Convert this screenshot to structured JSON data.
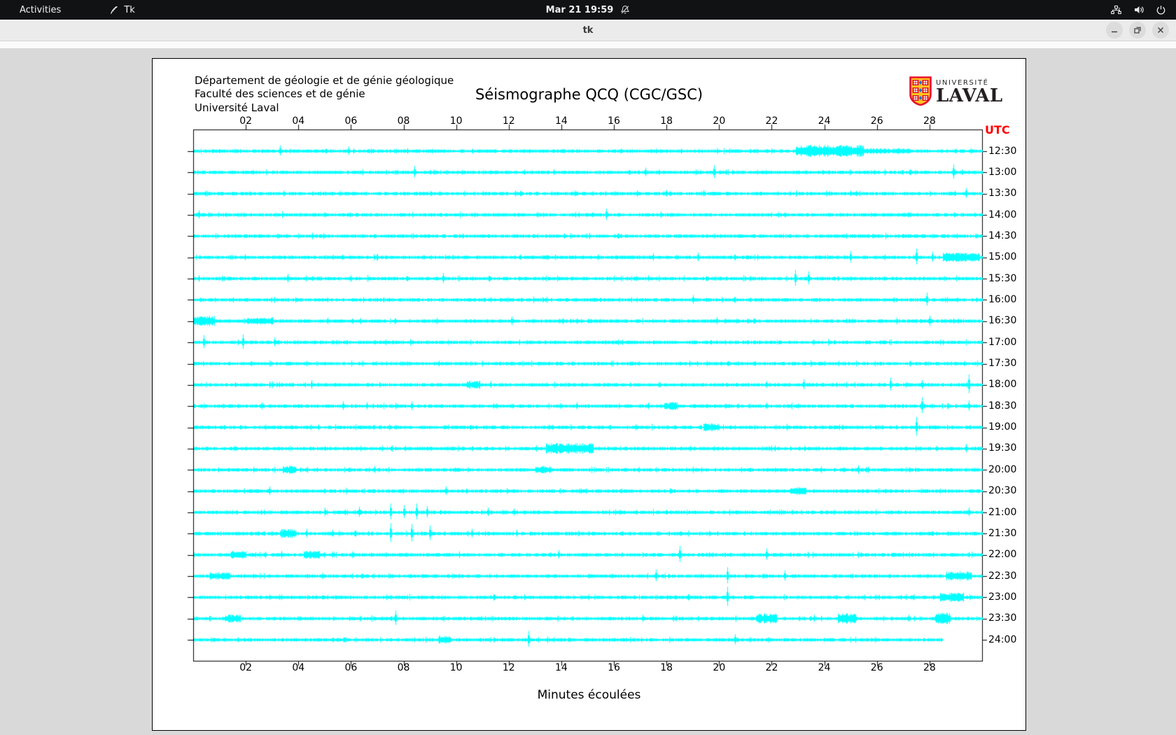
{
  "topbar": {
    "activities_label": "Activities",
    "app_name": "Tk",
    "clock": "Mar 21 19:59",
    "icons": [
      "feather-icon",
      "notifications-muted-icon",
      "network-icon",
      "volume-icon",
      "power-icon"
    ]
  },
  "titlebar": {
    "title": "tk",
    "buttons": [
      "minimize",
      "restore",
      "close"
    ]
  },
  "header": {
    "institution_lines": [
      "Département de géologie et de génie géologique",
      "Faculté des sciences et de génie",
      "Université Laval"
    ],
    "logo": {
      "line1": "UNIVERSITÉ",
      "line2": "LAVAL",
      "shield_colors": {
        "red": "#e8112d",
        "gold": "#ffc61e",
        "blue": "#1b7ac4",
        "white": "#ffffff"
      }
    }
  },
  "chart_data": {
    "type": "line",
    "subtype": "seismogram-helicorder",
    "title": "Séismographe QCQ (CGC/GSC)",
    "xlabel": "Minutes écoulées",
    "right_axis_label": "UTC",
    "right_axis_label_color": "#ff0000",
    "trace_color": "#00ffff",
    "x_range_minutes": [
      0,
      30
    ],
    "x_ticks": [
      "02",
      "04",
      "06",
      "08",
      "10",
      "12",
      "14",
      "16",
      "18",
      "20",
      "22",
      "24",
      "26",
      "28"
    ],
    "legend_position": "none",
    "grid": false,
    "rows": [
      {
        "label": "12:30",
        "spikes": [
          {
            "min": 3.3,
            "amp": 14
          },
          {
            "min": 5.9,
            "amp": 12
          }
        ],
        "bursts": [
          {
            "range": [
              22.9,
              25.5
            ],
            "amp": 9
          },
          {
            "range": [
              25.5,
              27.3
            ],
            "amp": 4
          }
        ]
      },
      {
        "label": "13:00",
        "spikes": [
          {
            "min": 8.4,
            "amp": 16
          },
          {
            "min": 13.7,
            "amp": 8
          },
          {
            "min": 17.2,
            "amp": 12
          },
          {
            "min": 19.8,
            "amp": 18
          },
          {
            "min": 28.9,
            "amp": 20
          }
        ],
        "bursts": []
      },
      {
        "label": "13:30",
        "spikes": [
          {
            "min": 18.0,
            "amp": 10
          },
          {
            "min": 19.4,
            "amp": 9
          },
          {
            "min": 25.0,
            "amp": 8
          },
          {
            "min": 29.4,
            "amp": 14
          }
        ],
        "bursts": []
      },
      {
        "label": "14:00",
        "spikes": [
          {
            "min": 0.2,
            "amp": 12
          },
          {
            "min": 15.7,
            "amp": 16
          }
        ],
        "bursts": []
      },
      {
        "label": "14:30",
        "spikes": [
          {
            "min": 27.0,
            "amp": 6
          }
        ],
        "bursts": []
      },
      {
        "label": "15:00",
        "spikes": [
          {
            "min": 17.5,
            "amp": 10
          },
          {
            "min": 19.2,
            "amp": 12
          },
          {
            "min": 25.0,
            "amp": 16
          },
          {
            "min": 27.5,
            "amp": 22
          },
          {
            "min": 28.1,
            "amp": 14
          }
        ],
        "bursts": [
          {
            "range": [
              28.5,
              29.9
            ],
            "amp": 7
          }
        ]
      },
      {
        "label": "15:30",
        "spikes": [
          {
            "min": 3.6,
            "amp": 12
          },
          {
            "min": 9.5,
            "amp": 14
          },
          {
            "min": 17.3,
            "amp": 8
          },
          {
            "min": 22.9,
            "amp": 22
          },
          {
            "min": 23.4,
            "amp": 18
          }
        ],
        "bursts": []
      },
      {
        "label": "16:00",
        "spikes": [
          {
            "min": 11.3,
            "amp": 7
          },
          {
            "min": 19.0,
            "amp": 12
          },
          {
            "min": 27.9,
            "amp": 18
          }
        ],
        "bursts": []
      },
      {
        "label": "16:30",
        "spikes": [
          {
            "min": 3.0,
            "amp": 10
          },
          {
            "min": 5.1,
            "amp": 9
          },
          {
            "min": 12.1,
            "amp": 12
          },
          {
            "min": 19.9,
            "amp": 10
          },
          {
            "min": 28.0,
            "amp": 14
          }
        ],
        "bursts": [
          {
            "range": [
              0,
              0.8
            ],
            "amp": 8
          },
          {
            "range": [
              2.0,
              3.0
            ],
            "amp": 5
          }
        ]
      },
      {
        "label": "17:00",
        "spikes": [
          {
            "min": 0.4,
            "amp": 18
          },
          {
            "min": 1.9,
            "amp": 20
          },
          {
            "min": 3.1,
            "amp": 12
          }
        ],
        "bursts": []
      },
      {
        "label": "17:30",
        "spikes": [],
        "bursts": []
      },
      {
        "label": "18:00",
        "spikes": [
          {
            "min": 4.5,
            "amp": 12
          },
          {
            "min": 11.3,
            "amp": 10
          },
          {
            "min": 21.8,
            "amp": 10
          },
          {
            "min": 23.2,
            "amp": 14
          },
          {
            "min": 26.5,
            "amp": 18
          },
          {
            "min": 27.7,
            "amp": 12
          },
          {
            "min": 29.5,
            "amp": 26
          }
        ],
        "bursts": [
          {
            "range": [
              10.4,
              10.9
            ],
            "amp": 6
          }
        ]
      },
      {
        "label": "18:30",
        "spikes": [
          {
            "min": 2.6,
            "amp": 10
          },
          {
            "min": 5.7,
            "amp": 12
          },
          {
            "min": 6.6,
            "amp": 10
          },
          {
            "min": 8.3,
            "amp": 12
          },
          {
            "min": 14.6,
            "amp": 10
          },
          {
            "min": 17.3,
            "amp": 9
          },
          {
            "min": 21.8,
            "amp": 9
          },
          {
            "min": 27.7,
            "amp": 22
          },
          {
            "min": 29.5,
            "amp": 14
          }
        ],
        "bursts": [
          {
            "range": [
              17.9,
              18.4
            ],
            "amp": 6
          }
        ]
      },
      {
        "label": "19:00",
        "spikes": [
          {
            "min": 9.7,
            "amp": 7
          },
          {
            "min": 27.5,
            "amp": 26
          }
        ],
        "bursts": [
          {
            "range": [
              19.4,
              20.0
            ],
            "amp": 6
          }
        ]
      },
      {
        "label": "19:30",
        "spikes": [
          {
            "min": 1.6,
            "amp": 6
          },
          {
            "min": 29.4,
            "amp": 12
          }
        ],
        "bursts": [
          {
            "range": [
              13.4,
              15.2
            ],
            "amp": 8
          }
        ]
      },
      {
        "label": "20:00",
        "spikes": [
          {
            "min": 6.9,
            "amp": 10
          },
          {
            "min": 25.3,
            "amp": 12
          }
        ],
        "bursts": [
          {
            "range": [
              3.4,
              3.9
            ],
            "amp": 6
          },
          {
            "range": [
              13.0,
              13.6
            ],
            "amp": 6
          }
        ]
      },
      {
        "label": "20:30",
        "spikes": [
          {
            "min": 2.9,
            "amp": 12
          },
          {
            "min": 9.6,
            "amp": 12
          },
          {
            "min": 28.6,
            "amp": 6
          }
        ],
        "bursts": [
          {
            "range": [
              22.7,
              23.3
            ],
            "amp": 6
          }
        ]
      },
      {
        "label": "21:00",
        "spikes": [
          {
            "min": 5.0,
            "amp": 12
          },
          {
            "min": 6.3,
            "amp": 14
          },
          {
            "min": 7.5,
            "amp": 22
          },
          {
            "min": 8.0,
            "amp": 18
          },
          {
            "min": 8.5,
            "amp": 22
          },
          {
            "min": 8.9,
            "amp": 16
          },
          {
            "min": 11.2,
            "amp": 12
          },
          {
            "min": 12.2,
            "amp": 10
          },
          {
            "min": 18.0,
            "amp": 7
          },
          {
            "min": 29.5,
            "amp": 12
          }
        ],
        "bursts": []
      },
      {
        "label": "21:30",
        "spikes": [
          {
            "min": 4.3,
            "amp": 12
          },
          {
            "min": 5.3,
            "amp": 10
          },
          {
            "min": 7.5,
            "amp": 26
          },
          {
            "min": 8.3,
            "amp": 24
          },
          {
            "min": 9.0,
            "amp": 20
          },
          {
            "min": 10.6,
            "amp": 12
          },
          {
            "min": 12.3,
            "amp": 10
          }
        ],
        "bursts": [
          {
            "range": [
              3.3,
              3.9
            ],
            "amp": 7
          }
        ]
      },
      {
        "label": "22:00",
        "spikes": [
          {
            "min": 3.35,
            "amp": 10
          },
          {
            "min": 5.3,
            "amp": 9
          },
          {
            "min": 13.9,
            "amp": 12
          },
          {
            "min": 18.5,
            "amp": 22
          },
          {
            "min": 21.8,
            "amp": 16
          },
          {
            "min": 25.4,
            "amp": 7
          }
        ],
        "bursts": [
          {
            "range": [
              1.4,
              2.0
            ],
            "amp": 6
          },
          {
            "range": [
              4.2,
              4.8
            ],
            "amp": 6
          }
        ]
      },
      {
        "label": "22:30",
        "spikes": [
          {
            "min": 17.6,
            "amp": 16
          },
          {
            "min": 20.3,
            "amp": 22
          },
          {
            "min": 22.5,
            "amp": 14
          }
        ],
        "bursts": [
          {
            "range": [
              0.6,
              1.4
            ],
            "amp": 6
          },
          {
            "range": [
              28.6,
              29.6
            ],
            "amp": 7
          }
        ]
      },
      {
        "label": "23:00",
        "spikes": [
          {
            "min": 11.3,
            "amp": 6
          },
          {
            "min": 20.3,
            "amp": 26
          }
        ],
        "bursts": [
          {
            "range": [
              28.4,
              29.3
            ],
            "amp": 7
          }
        ]
      },
      {
        "label": "23:30",
        "spikes": [
          {
            "min": 7.7,
            "amp": 20
          },
          {
            "min": 17.1,
            "amp": 10
          },
          {
            "min": 23.6,
            "amp": 10
          },
          {
            "min": 27.2,
            "amp": 10
          }
        ],
        "bursts": [
          {
            "range": [
              1.2,
              1.8
            ],
            "amp": 6
          },
          {
            "range": [
              21.4,
              22.2
            ],
            "amp": 8
          },
          {
            "range": [
              24.5,
              25.2
            ],
            "amp": 8
          },
          {
            "range": [
              28.2,
              28.8
            ],
            "amp": 9
          }
        ]
      },
      {
        "label": "24:00",
        "end_min": 28.5,
        "spikes": [
          {
            "min": 12.75,
            "amp": 22
          },
          {
            "min": 20.6,
            "amp": 14
          }
        ],
        "bursts": [
          {
            "range": [
              9.3,
              9.8
            ],
            "amp": 6
          }
        ]
      }
    ]
  }
}
